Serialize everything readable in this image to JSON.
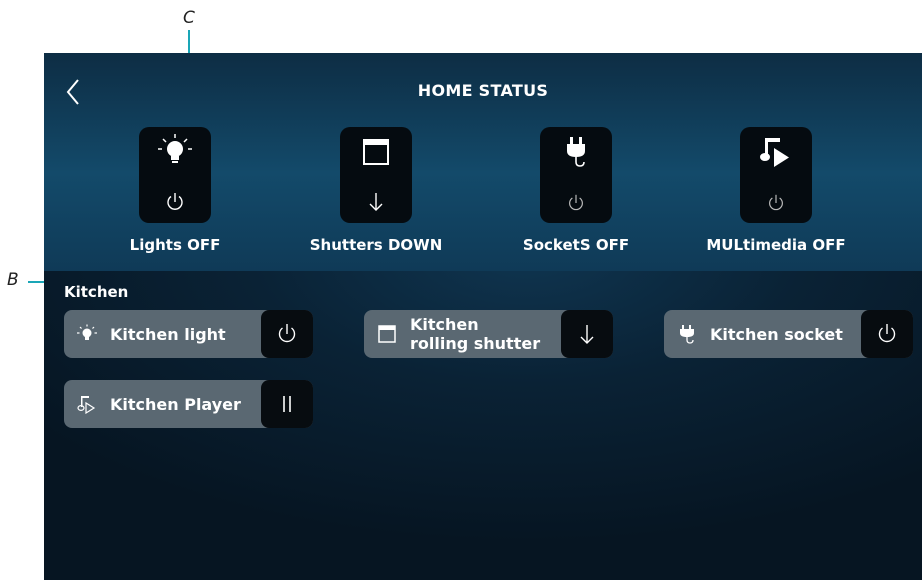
{
  "callouts": {
    "c": "C",
    "b": "B"
  },
  "header": {
    "title": "HOME STATUS"
  },
  "status_tiles": [
    {
      "label": "Lights OFF",
      "icon": "lightbulb-icon",
      "action_icon": "power-icon"
    },
    {
      "label": "Shutters DOWN",
      "icon": "shutter-icon",
      "action_icon": "arrow-down-icon"
    },
    {
      "label": "SocketS OFF",
      "icon": "socket-plug-icon",
      "action_icon": "power-icon"
    },
    {
      "label": "MULtimedia OFF",
      "icon": "music-play-icon",
      "action_icon": "power-icon"
    }
  ],
  "section": {
    "title": "Kitchen"
  },
  "devices": [
    {
      "line1": "Kitchen light",
      "line2": "",
      "icon": "lightbulb-icon",
      "action_icon": "power-icon"
    },
    {
      "line1": "Kitchen",
      "line2": "rolling shutter",
      "icon": "shutter-icon",
      "action_icon": "arrow-down-icon"
    },
    {
      "line1": "Kitchen socket",
      "line2": "",
      "icon": "socket-plug-icon",
      "action_icon": "power-icon"
    },
    {
      "line1": "Kitchen Player",
      "line2": "",
      "icon": "music-play-icon",
      "action_icon": "pause-icon"
    }
  ],
  "colors": {
    "accent": "#1aa6b7",
    "card": "#5a6872",
    "button": "#070c10",
    "background": "#0a2235"
  }
}
